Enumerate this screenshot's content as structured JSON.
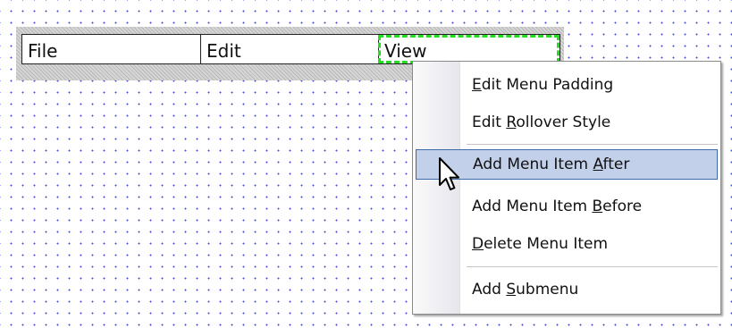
{
  "menubar": {
    "items": [
      {
        "label": "File"
      },
      {
        "label": "Edit"
      },
      {
        "label": "View"
      }
    ]
  },
  "context_menu": {
    "items": [
      {
        "before": "",
        "mnemonic": "E",
        "after": "dit Menu Padding"
      },
      {
        "before": "Edit ",
        "mnemonic": "R",
        "after": "ollover Style"
      },
      {
        "before": "Add Menu Item ",
        "mnemonic": "A",
        "after": "fter"
      },
      {
        "before": "Add Menu Item ",
        "mnemonic": "B",
        "after": "efore"
      },
      {
        "before": "",
        "mnemonic": "D",
        "after": "elete Menu Item"
      },
      {
        "before": "Add ",
        "mnemonic": "S",
        "after": "ubmenu"
      }
    ],
    "selected_index": 2
  },
  "colors": {
    "selection_dash": "#22dd22",
    "menu_highlight": "#c2d0ea",
    "menu_highlight_border": "#3f6aa8",
    "grid_dot": "#4a4ad8"
  },
  "cursor": {
    "icon": "arrow-cursor-icon"
  }
}
